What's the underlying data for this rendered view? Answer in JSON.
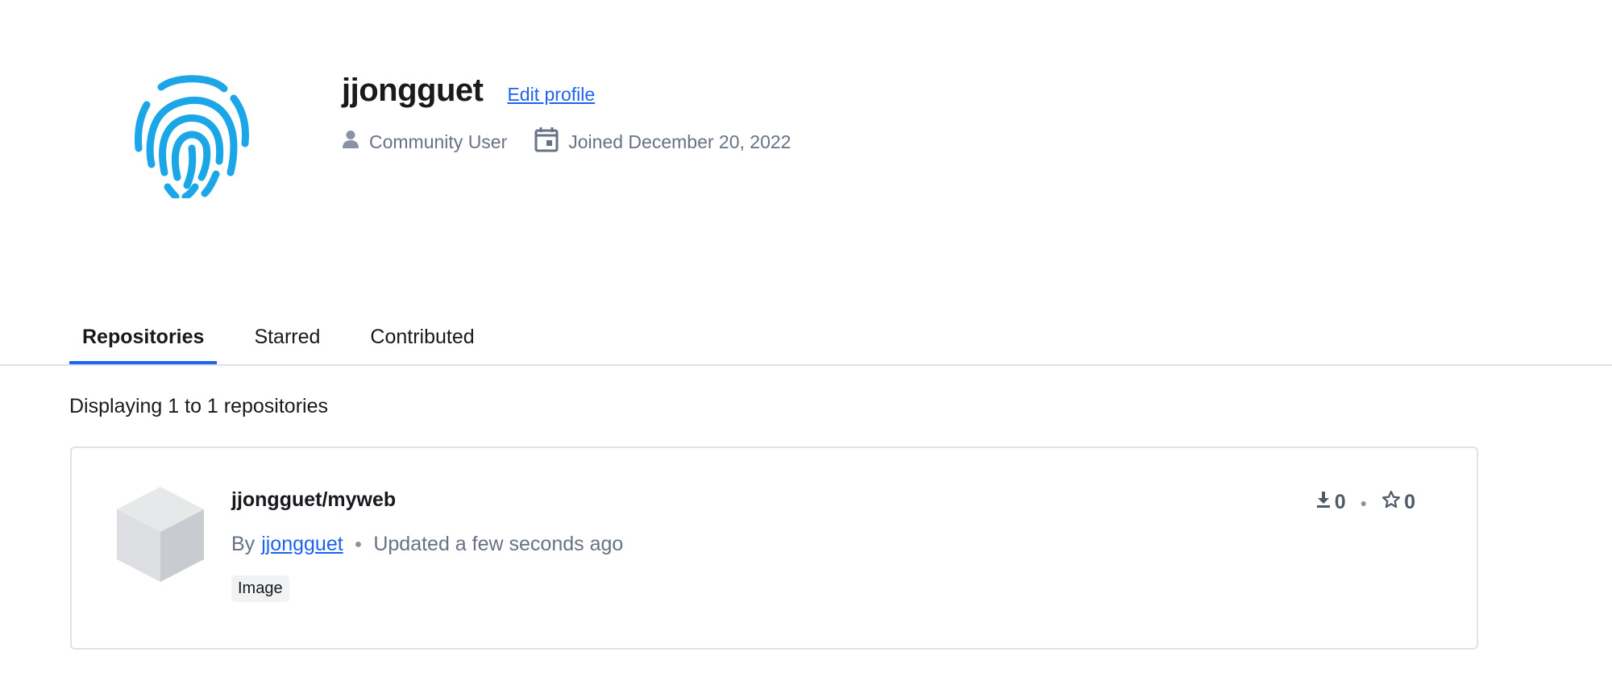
{
  "profile": {
    "username": "jjongguet",
    "edit_label": "Edit profile",
    "role": "Community User",
    "joined": "Joined December 20, 2022",
    "avatar_icon": "fingerprint-icon",
    "avatar_color": "#1ba6e8"
  },
  "tabs": [
    {
      "label": "Repositories",
      "active": true
    },
    {
      "label": "Starred",
      "active": false
    },
    {
      "label": "Contributed",
      "active": false
    }
  ],
  "repo_list": {
    "count_text": "Displaying 1 to 1 repositories",
    "items": [
      {
        "name": "jjongguet/myweb",
        "by_label": "By",
        "author": "jjongguet",
        "updated": "Updated a few seconds ago",
        "tag": "Image",
        "pulls": "0",
        "stars": "0"
      }
    ]
  },
  "colors": {
    "accent": "#1d63ed",
    "muted_text": "#677285",
    "border": "#e1e2e6"
  }
}
